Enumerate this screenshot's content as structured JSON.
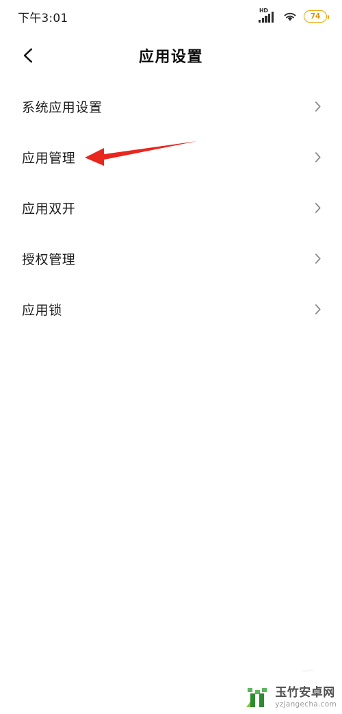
{
  "status_bar": {
    "time": "下午3:01",
    "network_label": "HD",
    "signal_icon": "signal-bars-icon",
    "wifi_icon": "wifi-icon",
    "battery_level": "74",
    "battery_color": "#f0a500"
  },
  "app_bar": {
    "back_icon": "back-chevron-icon",
    "title": "应用设置"
  },
  "list": {
    "items": [
      {
        "label": "系统应用设置",
        "chevron": "chevron-right-icon"
      },
      {
        "label": "应用管理",
        "chevron": "chevron-right-icon"
      },
      {
        "label": "应用双开",
        "chevron": "chevron-right-icon"
      },
      {
        "label": "授权管理",
        "chevron": "chevron-right-icon"
      },
      {
        "label": "应用锁",
        "chevron": "chevron-right-icon"
      }
    ]
  },
  "annotation": {
    "type": "arrow",
    "color": "#e8271f",
    "points_to": "应用管理"
  },
  "watermark": {
    "site_name": "玉竹安卓网",
    "url": "yzjangecha.com",
    "logo_color": "#3aa03a",
    "ghost_mark": "∽"
  }
}
